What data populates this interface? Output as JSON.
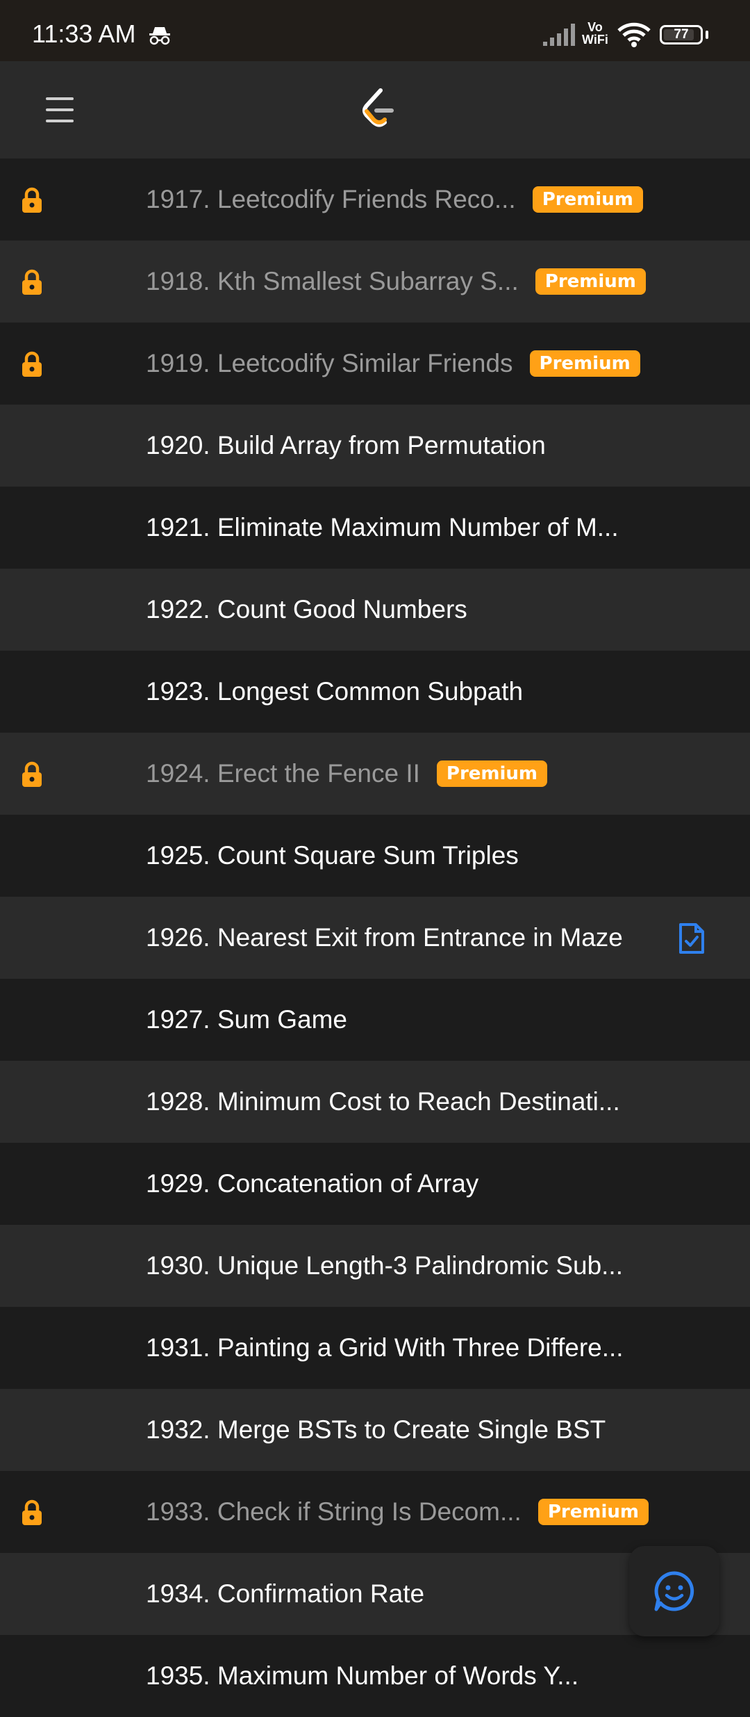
{
  "status_bar": {
    "time": "11:33 AM",
    "network_top": "Vo",
    "network_bottom": "WiFi",
    "battery": "77"
  },
  "colors": {
    "accent": "#ffa116",
    "solved_blue": "#2f80ed"
  },
  "problems": [
    {
      "title": "1917. Leetcodify Friends Reco...",
      "locked": true,
      "badge": "Premium"
    },
    {
      "title": "1918. Kth Smallest Subarray S...",
      "locked": true,
      "badge": "Premium"
    },
    {
      "title": "1919. Leetcodify Similar Friends",
      "locked": true,
      "badge": "Premium"
    },
    {
      "title": "1920. Build Array from Permutation",
      "locked": false
    },
    {
      "title": "1921. Eliminate Maximum Number of M...",
      "locked": false
    },
    {
      "title": "1922. Count Good Numbers",
      "locked": false
    },
    {
      "title": "1923. Longest Common Subpath",
      "locked": false
    },
    {
      "title": "1924. Erect the Fence II",
      "locked": true,
      "badge": "Premium"
    },
    {
      "title": "1925. Count Square Sum Triples",
      "locked": false
    },
    {
      "title": "1926. Nearest Exit from Entrance in Maze",
      "locked": false,
      "solved": true
    },
    {
      "title": "1927. Sum Game",
      "locked": false
    },
    {
      "title": "1928. Minimum Cost to Reach Destinati...",
      "locked": false
    },
    {
      "title": "1929. Concatenation of Array",
      "locked": false
    },
    {
      "title": "1930. Unique Length-3 Palindromic Sub...",
      "locked": false
    },
    {
      "title": "1931. Painting a Grid With Three Differe...",
      "locked": false
    },
    {
      "title": "1932. Merge BSTs to Create Single BST",
      "locked": false
    },
    {
      "title": "1933. Check if String Is Decom...",
      "locked": true,
      "badge": "Premium"
    },
    {
      "title": "1934. Confirmation Rate",
      "locked": false
    },
    {
      "title": "1935. Maximum Number of Words Y...",
      "locked": false
    }
  ]
}
